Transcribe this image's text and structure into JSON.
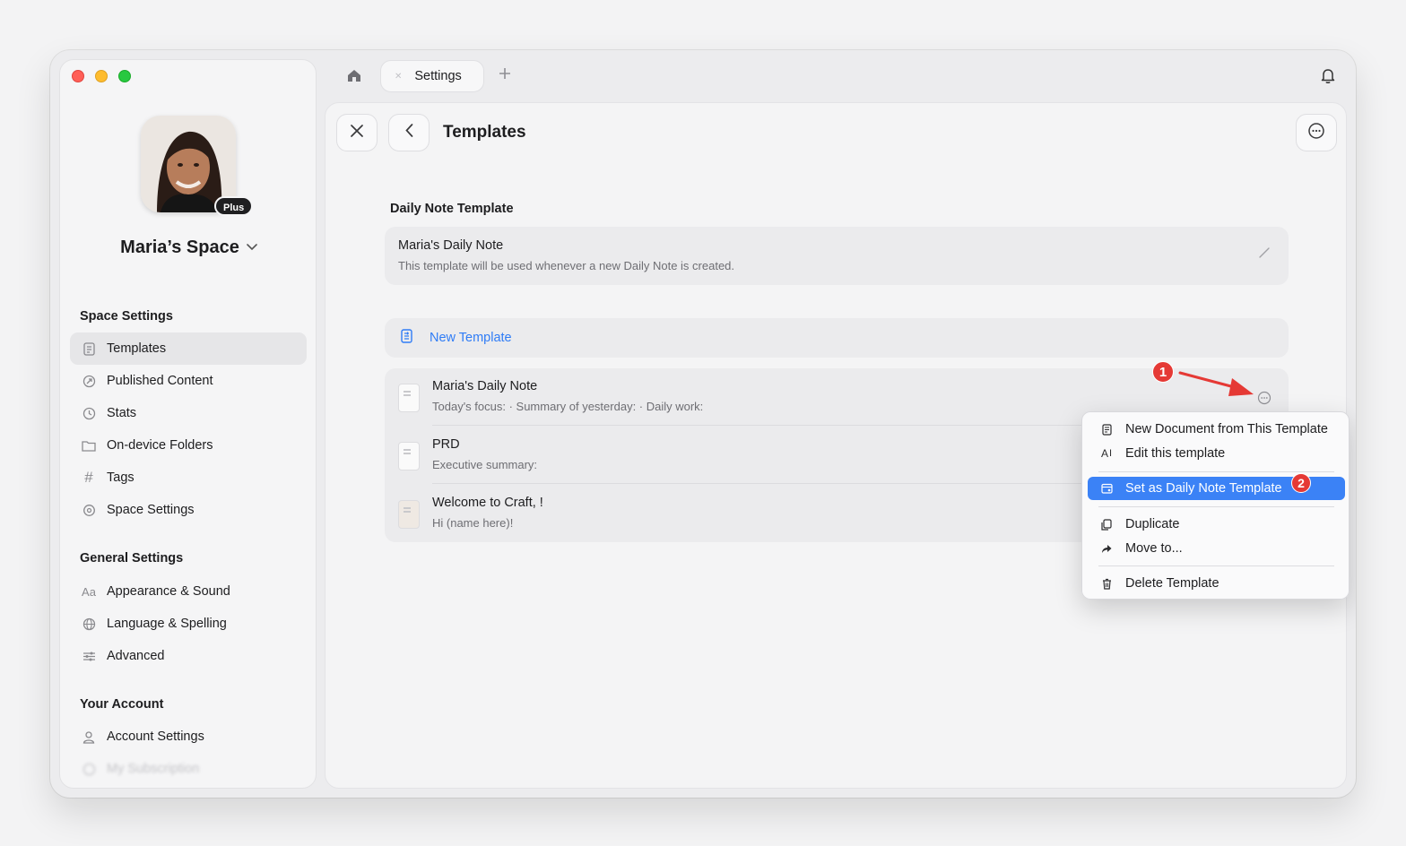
{
  "window": {
    "tab_label": "Settings"
  },
  "sidebar": {
    "badge": "Plus",
    "space_name": "Maria’s Space",
    "sections": [
      {
        "title": "Space Settings"
      },
      {
        "title": "General Settings"
      },
      {
        "title": "Your Account"
      }
    ],
    "items": [
      {
        "label": "Templates",
        "icon": "template-icon"
      },
      {
        "label": "Published Content",
        "icon": "published-icon"
      },
      {
        "label": "Stats",
        "icon": "stats-icon"
      },
      {
        "label": "On-device Folders",
        "icon": "folder-icon"
      },
      {
        "label": "Tags",
        "icon": "hash-icon"
      },
      {
        "label": "Space Settings",
        "icon": "gear-icon"
      },
      {
        "label": "Appearance & Sound",
        "icon": "text-size-icon"
      },
      {
        "label": "Language & Spelling",
        "icon": "globe-icon"
      },
      {
        "label": "Advanced",
        "icon": "sliders-icon"
      },
      {
        "label": "Account Settings",
        "icon": "person-icon"
      },
      {
        "label": "My Subscription",
        "icon": "subscription-icon"
      }
    ]
  },
  "main": {
    "title": "Templates",
    "daily_section_label": "Daily Note Template",
    "daily_card": {
      "title": "Maria's Daily Note",
      "description": "This template will be used whenever a new Daily Note is created."
    },
    "new_template_label": "New Template",
    "templates": [
      {
        "title": "Maria's Daily Note",
        "subtitle": "Today's focus: · Summary of yesterday: · Daily work:"
      },
      {
        "title": "PRD",
        "subtitle": "Executive summary:"
      },
      {
        "title": "Welcome to Craft, !",
        "subtitle": "Hi (name here)!"
      }
    ]
  },
  "context_menu": {
    "items": [
      {
        "label": "New Document from This Template",
        "icon": "new-doc-icon"
      },
      {
        "label": "Edit this template",
        "icon": "edit-text-icon"
      },
      {
        "label": "Set as Daily Note Template",
        "icon": "calendar-icon",
        "highlighted": true
      },
      {
        "label": "Duplicate",
        "icon": "duplicate-icon"
      },
      {
        "label": "Move to...",
        "icon": "move-arrow-icon"
      },
      {
        "label": "Delete Template",
        "icon": "trash-icon"
      }
    ]
  },
  "annotations": {
    "step1": "1",
    "step2": "2",
    "color": "#e53935"
  },
  "colors": {
    "accent": "#2f7cf6",
    "highlight": "#3b82f6"
  }
}
